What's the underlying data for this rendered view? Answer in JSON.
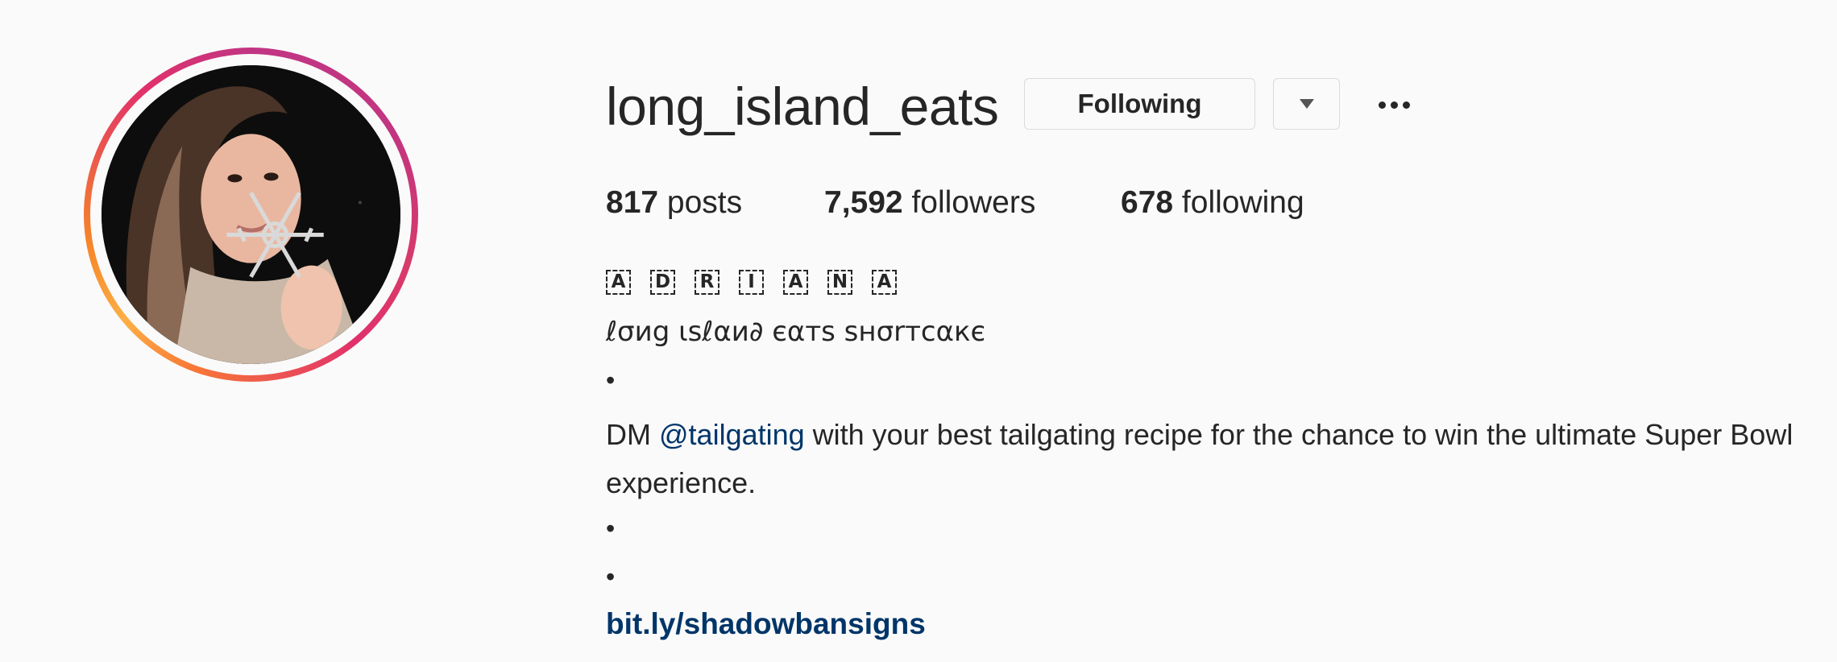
{
  "profile": {
    "username": "long_island_eats",
    "following_button_label": "Following",
    "stats": {
      "posts_count": "817",
      "posts_label": "posts",
      "followers_count": "7,592",
      "followers_label": "followers",
      "following_count": "678",
      "following_label": "following"
    },
    "bio": {
      "fullname_letters": [
        "A",
        "D",
        "R",
        "I",
        "A",
        "N",
        "A"
      ],
      "tagline": "ℓσиg ιѕℓαи∂ єαтѕ ѕнσrтcαкє",
      "bullet": "•",
      "promo_before": "DM ",
      "promo_mention": "@tailgating",
      "promo_after": " with your best tailgating recipe for the chance to win the ultimate Super Bowl experience.",
      "link": "bit.ly/shadowbansigns"
    }
  },
  "colors": {
    "link": "#003569",
    "text": "#262626",
    "border": "#dbdbdb",
    "background": "#fafafa",
    "story_ring_start": "#c13584",
    "story_ring_end": "#f58529"
  },
  "icons": {
    "dropdown": "caret-down-icon",
    "more": "ellipsis-icon"
  }
}
